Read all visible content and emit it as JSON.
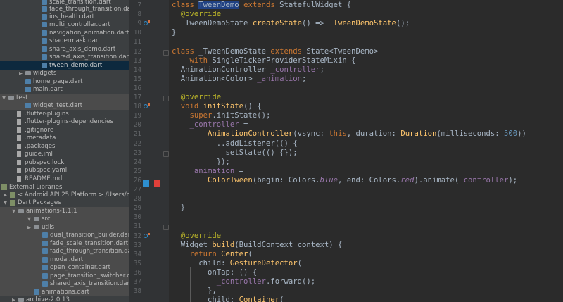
{
  "colors": {
    "accent_selection": "#214283",
    "keyword": "#cc7832",
    "function": "#ffc66d",
    "number": "#6897bb",
    "field": "#9876aa",
    "annotation": "#bbb529",
    "blue_swatch": "#2e8fcf",
    "red_swatch": "#e0403a"
  },
  "tree": {
    "rows": [
      {
        "label": "scale_transition.dart",
        "icon": "dart-file-icon"
      },
      {
        "label": "fade_through_transition.dart",
        "icon": "dart-file-icon"
      },
      {
        "label": "ios_health.dart",
        "icon": "dart-file-icon"
      },
      {
        "label": "multi_controller.dart",
        "icon": "dart-file-icon"
      },
      {
        "label": "navigation_animation.dart",
        "icon": "dart-file-icon"
      },
      {
        "label": "shadermask.dart",
        "icon": "dart-file-icon"
      },
      {
        "label": "share_axis_demo.dart",
        "icon": "dart-file-icon"
      },
      {
        "label": "shared_axis_transition.dart",
        "icon": "dart-file-icon"
      },
      {
        "label": "tween_demo.dart",
        "icon": "dart-file-icon",
        "selected": true
      },
      {
        "label": "widgets",
        "icon": "folder-icon",
        "arrow": "▶"
      },
      {
        "label": "home_page.dart",
        "icon": "dart-file-icon"
      },
      {
        "label": "main.dart",
        "icon": "dart-file-icon"
      },
      {
        "label": "test",
        "icon": "folder-icon",
        "arrow": "▼"
      },
      {
        "label": "widget_test.dart",
        "icon": "dart-file-icon"
      },
      {
        "label": ".flutter-plugins",
        "icon": "file-icon"
      },
      {
        "label": ".flutter-plugins-dependencies",
        "icon": "file-icon"
      },
      {
        "label": ".gitignore",
        "icon": "file-icon"
      },
      {
        "label": ".metadata",
        "icon": "file-icon"
      },
      {
        "label": ".packages",
        "icon": "file-icon"
      },
      {
        "label": "guide.iml",
        "icon": "file-icon"
      },
      {
        "label": "pubspec.lock",
        "icon": "file-icon"
      },
      {
        "label": "pubspec.yaml",
        "icon": "file-icon"
      },
      {
        "label": "README.md",
        "icon": "file-icon"
      },
      {
        "label": "External Libraries",
        "icon": "library-icon",
        "arrow": "▼"
      },
      {
        "label": "< Android API 25 Platform >  /Users/me",
        "icon": "library-icon",
        "arrow": "▶"
      },
      {
        "label": "Dart Packages",
        "icon": "library-icon",
        "arrow": "▼"
      },
      {
        "label": "animations-1.1.1",
        "icon": "folder-icon",
        "arrow": "▼"
      },
      {
        "label": "src",
        "icon": "folder-icon",
        "arrow": "▼"
      },
      {
        "label": "utils",
        "icon": "folder-icon",
        "arrow": "▶"
      },
      {
        "label": "dual_transition_builder.dart",
        "icon": "dart-file-icon"
      },
      {
        "label": "fade_scale_transition.dart",
        "icon": "dart-file-icon"
      },
      {
        "label": "fade_through_transition.dart",
        "icon": "dart-file-icon"
      },
      {
        "label": "modal.dart",
        "icon": "dart-file-icon"
      },
      {
        "label": "open_container.dart",
        "icon": "dart-file-icon"
      },
      {
        "label": "page_transition_switcher.dart",
        "icon": "dart-file-icon"
      },
      {
        "label": "shared_axis_transition.dart",
        "icon": "dart-file-icon"
      },
      {
        "label": "animations.dart",
        "icon": "dart-file-icon"
      },
      {
        "label": "archive-2.0.13",
        "icon": "folder-icon",
        "arrow": "▶"
      }
    ]
  },
  "editor": {
    "line_numbers": [
      "7",
      "8",
      "9",
      "10",
      "11",
      "12",
      "13",
      "14",
      "15",
      "16",
      "17",
      "18",
      "19",
      "20",
      "21",
      "22",
      "23",
      "24",
      "25",
      "26",
      "27",
      "28",
      "29",
      "30",
      "31",
      "32",
      "33",
      "34",
      "35",
      "36",
      "37",
      "38"
    ],
    "lines": [
      [
        [
          "kw",
          "class "
        ],
        [
          "sel",
          "TweenDemo"
        ],
        [
          "kw",
          " extends "
        ],
        [
          "",
          "StatefulWidget {"
        ]
      ],
      [
        [
          "an",
          "  @override"
        ]
      ],
      [
        [
          "",
          "  _TweenDemoState "
        ],
        [
          "fn",
          "createState"
        ],
        [
          "",
          "() => "
        ],
        [
          "fn",
          "_TweenDemoState"
        ],
        [
          "",
          "();"
        ]
      ],
      [
        [
          "",
          "}"
        ]
      ],
      [
        [
          "",
          ""
        ]
      ],
      [
        [
          "kw",
          "class "
        ],
        [
          "",
          "_TweenDemoState "
        ],
        [
          "kw",
          "extends "
        ],
        [
          "",
          "State<TweenDemo>"
        ]
      ],
      [
        [
          "kw",
          "    with "
        ],
        [
          "",
          "SingleTickerProviderStateMixin {"
        ]
      ],
      [
        [
          "",
          "  AnimationController "
        ],
        [
          "pv",
          "_controller"
        ],
        [
          "",
          ";"
        ]
      ],
      [
        [
          "",
          "  Animation<Color> "
        ],
        [
          "pv",
          "_animation"
        ],
        [
          "",
          ";"
        ]
      ],
      [
        [
          "",
          ""
        ]
      ],
      [
        [
          "an",
          "  @override"
        ]
      ],
      [
        [
          "kw",
          "  void "
        ],
        [
          "fn",
          "initState"
        ],
        [
          "",
          "() {"
        ]
      ],
      [
        [
          "kw",
          "    super"
        ],
        [
          "",
          ".initState();"
        ]
      ],
      [
        [
          "pv",
          "    _controller"
        ],
        [
          "",
          " ="
        ]
      ],
      [
        [
          "fn",
          "        AnimationController"
        ],
        [
          "",
          "(vsync: "
        ],
        [
          "kw",
          "this"
        ],
        [
          "",
          ", duration: "
        ],
        [
          "fn",
          "Duration"
        ],
        [
          "",
          "(milliseconds: "
        ],
        [
          "nm",
          "500"
        ],
        [
          "",
          "))"
        ]
      ],
      [
        [
          "",
          "          ..addListener(() {"
        ]
      ],
      [
        [
          "",
          "            setState(() {});"
        ]
      ],
      [
        [
          "",
          "          });"
        ]
      ],
      [
        [
          "pv",
          "    _animation"
        ],
        [
          "",
          " ="
        ]
      ],
      [
        [
          "fn",
          "        ColorTween"
        ],
        [
          "",
          "(begin: Colors."
        ],
        [
          "pvi",
          "blue"
        ],
        [
          "",
          ", end: Colors."
        ],
        [
          "pvi",
          "red"
        ],
        [
          "",
          ").animate("
        ],
        [
          "pv",
          "_controller"
        ],
        [
          "",
          ");"
        ]
      ],
      [
        [
          "",
          ""
        ]
      ],
      [
        [
          "",
          ""
        ]
      ],
      [
        [
          "",
          "  }"
        ]
      ],
      [
        [
          "",
          ""
        ]
      ],
      [
        [
          "",
          ""
        ]
      ],
      [
        [
          "an",
          "  @override"
        ]
      ],
      [
        [
          "",
          "  Widget "
        ],
        [
          "fn",
          "build"
        ],
        [
          "",
          "(BuildContext context) {"
        ]
      ],
      [
        [
          "kw",
          "    return "
        ],
        [
          "fn",
          "Center"
        ],
        [
          "",
          "("
        ]
      ],
      [
        [
          "",
          "      child: "
        ],
        [
          "fn",
          "GestureDetector"
        ],
        [
          "",
          "("
        ]
      ],
      [
        [
          "",
          "        onTap: () {"
        ]
      ],
      [
        [
          "pv",
          "          _controller"
        ],
        [
          "",
          ".forward();"
        ]
      ],
      [
        [
          "",
          "        },"
        ]
      ],
      [
        [
          "",
          "        child: "
        ],
        [
          "fn",
          "Container"
        ],
        [
          "",
          "("
        ]
      ]
    ]
  }
}
